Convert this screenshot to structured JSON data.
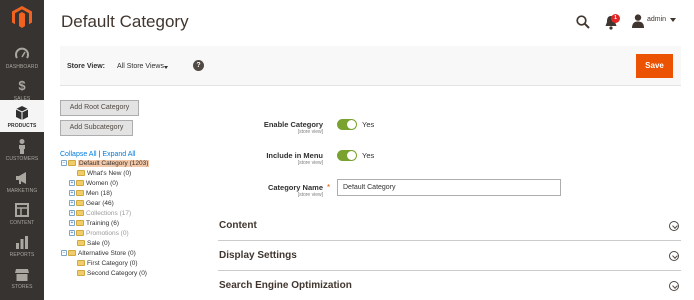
{
  "sidebar": {
    "items": [
      {
        "label": "DASHBOARD",
        "icon": "speedometer-icon"
      },
      {
        "label": "SALES",
        "icon": "dollar-icon"
      },
      {
        "label": "PRODUCTS",
        "icon": "box-icon",
        "active": true
      },
      {
        "label": "CUSTOMERS",
        "icon": "person-icon"
      },
      {
        "label": "MARKETING",
        "icon": "megaphone-icon"
      },
      {
        "label": "CONTENT",
        "icon": "layout-icon"
      },
      {
        "label": "REPORTS",
        "icon": "bar-chart-icon"
      },
      {
        "label": "STORES",
        "icon": "store-icon"
      }
    ]
  },
  "header": {
    "title": "Default Category",
    "notifications_count": "1",
    "user": "admin"
  },
  "store_view": {
    "label": "Store View:",
    "value": "All Store Views",
    "help": "?",
    "save_label": "Save"
  },
  "buttons": {
    "add_root": "Add Root Category",
    "add_sub": "Add Subcategory"
  },
  "tree": {
    "collapse_all": "Collapse All",
    "separator": "|",
    "expand_all": "Expand All",
    "nodes": [
      {
        "text": "Default Category (1203)",
        "toggle": "−",
        "selected": true
      },
      {
        "text": "What's New (0)"
      },
      {
        "text": "Women (0)",
        "toggle": "+"
      },
      {
        "text": "Men (18)",
        "toggle": "+"
      },
      {
        "text": "Gear (46)",
        "toggle": "+"
      },
      {
        "text": "Collections (17)",
        "toggle": "+",
        "disabled": true
      },
      {
        "text": "Training (6)",
        "toggle": "+"
      },
      {
        "text": "Promotions (0)",
        "toggle": "+",
        "disabled": true
      },
      {
        "text": "Sale (0)"
      },
      {
        "text": "Alternative Store (0)",
        "toggle": "−"
      },
      {
        "text": "First Category (0)"
      },
      {
        "text": "Second Category (0)"
      }
    ]
  },
  "form": {
    "enable_category": {
      "label": "Enable Category",
      "scope": "[store view]",
      "value": "Yes"
    },
    "include_in_menu": {
      "label": "Include in Menu",
      "scope": "[store view]",
      "value": "Yes"
    },
    "category_name": {
      "label": "Category Name",
      "scope": "[store view]",
      "required_mark": "*",
      "value": "Default Category"
    }
  },
  "sections": [
    {
      "title": "Content"
    },
    {
      "title": "Display Settings"
    },
    {
      "title": "Search Engine Optimization"
    }
  ],
  "colors": {
    "sidebar_bg": "#373330",
    "save_button": "#eb5202",
    "toggle_on": "#79a22e",
    "link": "#007bdb"
  }
}
